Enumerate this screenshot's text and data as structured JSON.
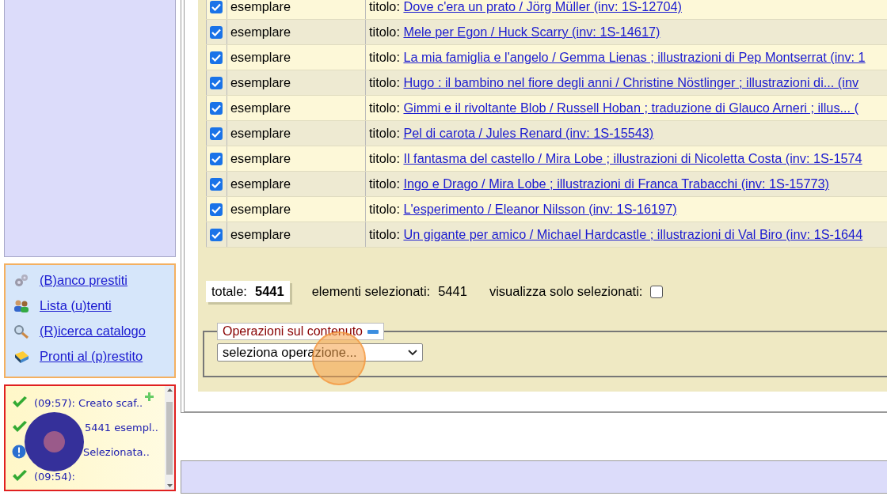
{
  "nav": [
    {
      "label": "(B)anco prestiti"
    },
    {
      "label": "Lista (u)tenti"
    },
    {
      "label": "(R)icerca catalogo"
    },
    {
      "label": "Pronti al (p)restito"
    }
  ],
  "log": [
    {
      "kind": "ok",
      "text": "(09:57): Creato scaf..",
      "covered": false
    },
    {
      "kind": "ok",
      "text": "5441 esempl..",
      "covered": true
    },
    {
      "kind": "info",
      "text": "Selezionata..",
      "covered": true
    },
    {
      "kind": "ok",
      "text": "(09:54):",
      "covered": false
    }
  ],
  "rows": [
    {
      "checked": true,
      "type": "esemplare",
      "label": "titolo:",
      "title": "Dove c'era un prato / Jörg Müller (inv: 1S-12704)"
    },
    {
      "checked": true,
      "type": "esemplare",
      "label": "titolo:",
      "title": "Mele per Egon / Huck Scarry (inv: 1S-14617)"
    },
    {
      "checked": true,
      "type": "esemplare",
      "label": "titolo:",
      "title": "La mia famiglia e l'angelo / Gemma Lienas ; illustrazioni di Pep Montserrat (inv: 1"
    },
    {
      "checked": true,
      "type": "esemplare",
      "label": "titolo:",
      "title": "Hugo : il bambino nel fiore degli anni / Christine Nöstlinger ; illustrazioni di... (inv"
    },
    {
      "checked": true,
      "type": "esemplare",
      "label": "titolo:",
      "title": "Gimmi e il rivoltante Blob / Russell Hoban ; traduzione di Glauco Arneri ; illus... ("
    },
    {
      "checked": true,
      "type": "esemplare",
      "label": "titolo:",
      "title": "Pel di carota / Jules Renard (inv: 1S-15543)"
    },
    {
      "checked": true,
      "type": "esemplare",
      "label": "titolo:",
      "title": "Il fantasma del castello / Mira Lobe ; illustrazioni di Nicoletta Costa (inv: 1S-1574"
    },
    {
      "checked": true,
      "type": "esemplare",
      "label": "titolo:",
      "title": "Ingo e Drago / Mira Lobe ; illustrazioni di Franca Trabacchi (inv: 1S-15773)"
    },
    {
      "checked": true,
      "type": "esemplare",
      "label": "titolo:",
      "title": "L'esperimento / Eleanor Nilsson (inv: 1S-16197)"
    },
    {
      "checked": true,
      "type": "esemplare",
      "label": "titolo:",
      "title": "Un gigante per amico / Michael Hardcastle ; illustrazioni di Val Biro (inv: 1S-1644"
    }
  ],
  "summary": {
    "total_label": "totale:",
    "total": "5441",
    "selected_label": "elementi selezionati:",
    "selected": "5441",
    "only_selected_label": "visualizza solo selezionati:",
    "only_selected": false
  },
  "operations": {
    "legend": "Operazioni sul contenuto",
    "select": "seleziona operazione..."
  }
}
